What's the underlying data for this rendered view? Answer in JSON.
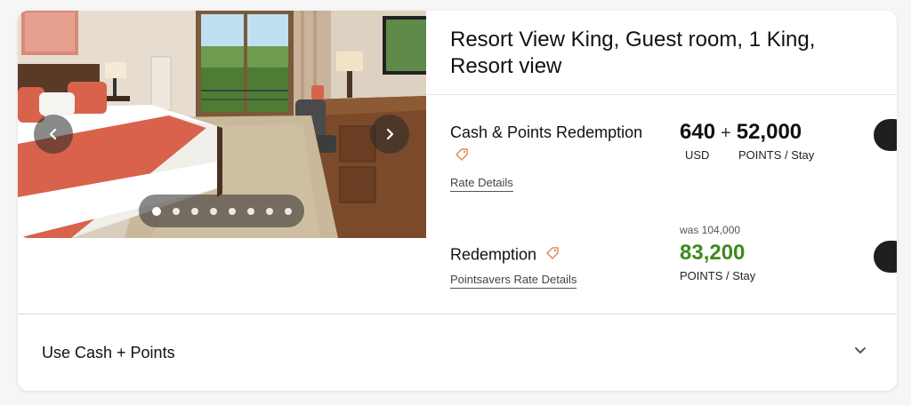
{
  "room": {
    "title": "Resort View King, Guest room, 1 King, Resort view"
  },
  "carousel": {
    "prev_icon": "chevron-left-icon",
    "next_icon": "chevron-right-icon",
    "image_count": 8,
    "active_index": 0
  },
  "rates": [
    {
      "name": "Cash & Points Redemption",
      "icon": "tag-icon",
      "details_link": "Rate Details",
      "cash_amount": "640",
      "plus": "+",
      "cash_unit": "USD",
      "points_amount": "52,000",
      "points_unit": "POINTS / Stay"
    },
    {
      "name": "Redemption",
      "icon": "tag-icon",
      "details_link": "Pointsavers Rate Details",
      "was_label": "was 104,000",
      "points_amount": "83,200",
      "points_unit": "POINTS / Stay"
    }
  ],
  "accordion": {
    "label": "Use Cash + Points",
    "icon": "chevron-down-icon"
  },
  "colors": {
    "accent_green": "#3f8a1c",
    "tag_orange": "#e2885e",
    "button_dark": "#1f1f1f"
  }
}
